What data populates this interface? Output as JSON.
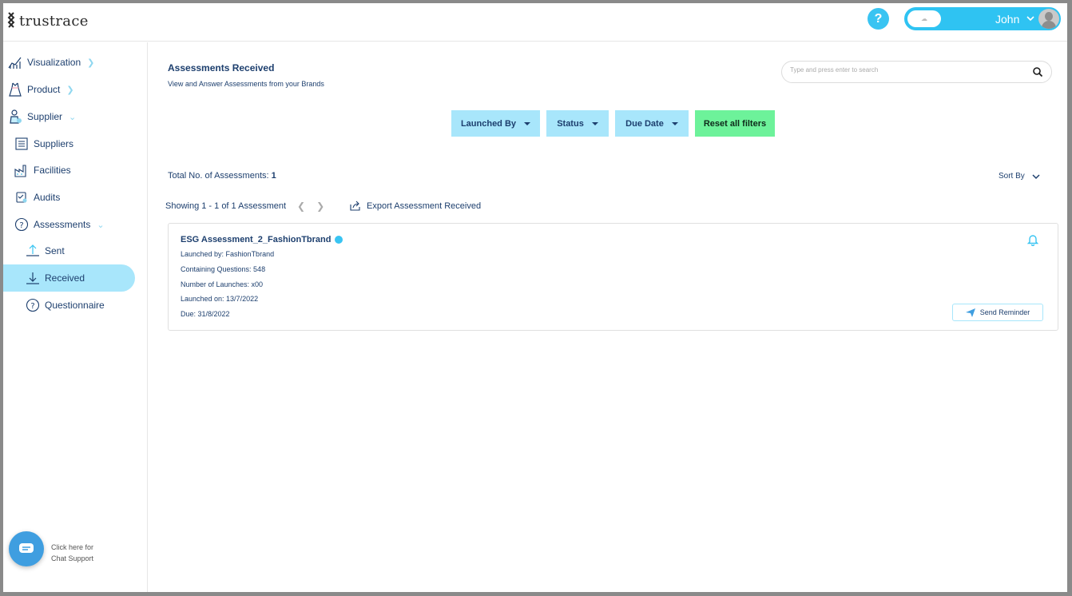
{
  "header": {
    "logo_text": "trustrace",
    "help_label": "?",
    "user_name": "John",
    "toggle_label": "☁"
  },
  "sidebar": {
    "items": [
      {
        "label": "Visualization",
        "icon": "chart-icon"
      },
      {
        "label": "Product",
        "icon": "dress-icon"
      },
      {
        "label": "Supplier",
        "icon": "supplier-icon"
      },
      {
        "label": "Suppliers",
        "icon": "list-icon"
      },
      {
        "label": "Facilities",
        "icon": "factory-icon"
      },
      {
        "label": "Audits",
        "icon": "audit-icon"
      },
      {
        "label": "Assessments",
        "icon": "question-icon"
      },
      {
        "label": "Sent",
        "icon": "upload-icon"
      },
      {
        "label": "Received",
        "icon": "download-icon"
      },
      {
        "label": "Questionnaire",
        "icon": "question-icon"
      }
    ],
    "chat_line1": "Click here for",
    "chat_line2": "Chat Support"
  },
  "main": {
    "title": "Assessments Received",
    "subtitle": "View and Answer Assessments from your Brands",
    "search_placeholder": "Type and press enter to search",
    "filters": {
      "launched_by": "Launched By",
      "status": "Status",
      "due_date": "Due Date",
      "reset": "Reset all filters"
    },
    "total_label": "Total No. of Assessments:",
    "total_value": "1",
    "sort_by": "Sort By",
    "showing": "Showing 1 - 1 of 1 Assessment",
    "export": "Export Assessment Received"
  },
  "card": {
    "title": "ESG Assessment_2_FashionTbrand",
    "launched_by": "Launched by: FashionTbrand",
    "questions": "Containing Questions: 548",
    "launches": "Number of Launches: x00",
    "launched_on": "Launched on: 13/7/2022",
    "due": "Due: 31/8/2022",
    "reminder": "Send Reminder"
  },
  "colors": {
    "accent": "#39c4f2",
    "active_bg": "#a8e6fb",
    "reset_green": "#6df29a",
    "text_navy": "#1d3f6e"
  }
}
